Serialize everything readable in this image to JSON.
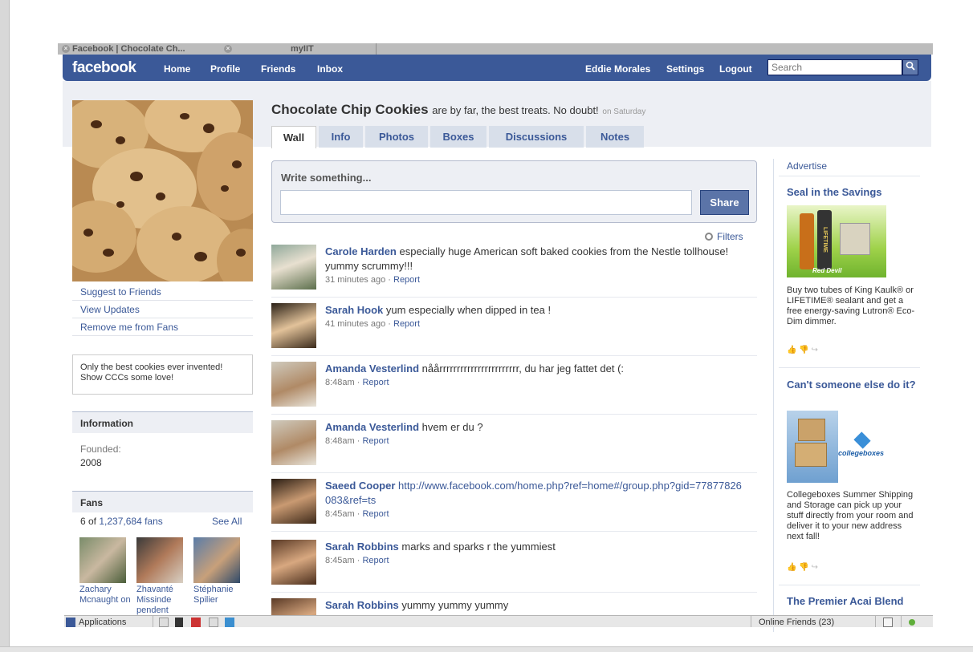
{
  "browser": {
    "tabs": [
      {
        "label": "Facebook | Chocolate Ch..."
      },
      {
        "label": "myIIT"
      }
    ]
  },
  "topbar": {
    "logo": "facebook",
    "nav": [
      "Home",
      "Profile",
      "Friends",
      "Inbox"
    ],
    "user": "Eddie Morales",
    "settings": "Settings",
    "logout": "Logout",
    "search_placeholder": "Search"
  },
  "page": {
    "name": "Chocolate Chip Cookies",
    "status": "are by far, the best treats. No doubt!",
    "status_time": "on Saturday",
    "tabs": [
      "Wall",
      "Info",
      "Photos",
      "Boxes",
      "Discussions",
      "Notes"
    ],
    "active_tab": "Wall"
  },
  "sidebar": {
    "links": [
      "Suggest to Friends",
      "View Updates",
      "Remove me from Fans"
    ],
    "description": "Only the best cookies ever invented! Show CCCs some love!",
    "information_title": "Information",
    "founded_label": "Founded:",
    "founded_value": "2008",
    "fans_title": "Fans",
    "fans_count_prefix": "6 of",
    "fans_count": "1,237,684 fans",
    "see_all": "See All",
    "fans": [
      {
        "name": "Zachary Mcnaught on"
      },
      {
        "name": "Zhavanté Missinde pendent"
      },
      {
        "name": "Stéphanie Spilier"
      }
    ]
  },
  "composer": {
    "label": "Write something...",
    "share": "Share"
  },
  "filters": "Filters",
  "posts": [
    {
      "author": "Carole Harden",
      "text": "especially huge American soft baked cookies from the Nestle tollhouse! yummy scrummy!!!",
      "time": "31 minutes ago",
      "report": "Report"
    },
    {
      "author": "Sarah Hook",
      "text": "yum especially when dipped in tea !",
      "time": "41 minutes ago",
      "report": "Report"
    },
    {
      "author": "Amanda Vesterlind",
      "text": "nåårrrrrrrrrrrrrrrrrrrrrrr, du har jeg fattet det (:",
      "time": "8:48am",
      "report": "Report"
    },
    {
      "author": "Amanda Vesterlind",
      "text": "hvem er du ?",
      "time": "8:48am",
      "report": "Report"
    },
    {
      "author": "Saeed Cooper",
      "text": "http://www.facebook.com/home.php?ref=home#/group.php?gid=77877826083&ref=ts",
      "time": "8:45am",
      "report": "Report"
    },
    {
      "author": "Sarah Robbins",
      "text": "marks and sparks r the yummiest",
      "time": "8:45am",
      "report": "Report"
    },
    {
      "author": "Sarah Robbins",
      "text": "yummy yummy yummy",
      "time": "",
      "report": ""
    }
  ],
  "ads": {
    "advertise": "Advertise",
    "items": [
      {
        "title": "Seal in the Savings",
        "text": "Buy two tubes of King Kaulk® or LIFETIME® sealant and get a free energy-saving Lutron® Eco-Dim dimmer.",
        "image_labels": [
          "LIFETIME",
          "Red Devil"
        ]
      },
      {
        "title": "Can't someone else do it?",
        "text": "Collegeboxes Summer Shipping and Storage can pick up your stuff directly from your room and deliver it to your new address next fall!",
        "image_labels": [
          "collegeboxes"
        ]
      },
      {
        "title": "The Premier Acai Blend",
        "text": "",
        "image_labels": []
      }
    ]
  },
  "chatbar": {
    "applications": "Applications",
    "online": "Online Friends (23)"
  }
}
